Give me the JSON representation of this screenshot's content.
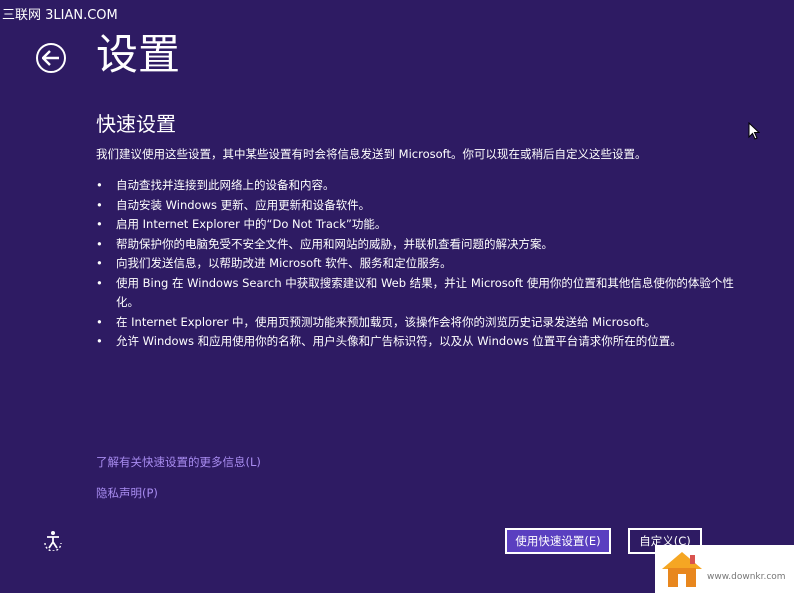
{
  "watermark": "三联网 3LIAN.COM",
  "header": {
    "title": "设置"
  },
  "section": {
    "title": "快速设置",
    "intro": "我们建议使用这些设置，其中某些设置有时会将信息发送到 Microsoft。你可以现在或稍后自定义这些设置。"
  },
  "items": [
    "自动查找并连接到此网络上的设备和内容。",
    "自动安装 Windows 更新、应用更新和设备软件。",
    "启用 Internet Explorer 中的“Do Not Track”功能。",
    "帮助保护你的电脑免受不安全文件、应用和网站的威胁，并联机查看问题的解决方案。",
    "向我们发送信息，以帮助改进 Microsoft 软件、服务和定位服务。",
    "使用 Bing 在 Windows Search 中获取搜索建议和 Web 结果，并让 Microsoft 使用你的位置和其他信息使你的体验个性化。",
    "在 Internet Explorer 中，使用页预测功能来预加载页，该操作会将你的浏览历史记录发送给 Microsoft。",
    "允许 Windows 和应用使用你的名称、用户头像和广告标识符，以及从 Windows 位置平台请求你所在的位置。"
  ],
  "links": {
    "more_info": "了解有关快速设置的更多信息(L)",
    "privacy": "隐私声明(P)"
  },
  "buttons": {
    "express": "使用快速设置(E)",
    "custom": "自定义(C)"
  },
  "logo": {
    "text": "www.downkr.com"
  },
  "colors": {
    "background": "#2e1b63",
    "accent_button": "#5a3fc0",
    "link": "#a88cf0"
  }
}
